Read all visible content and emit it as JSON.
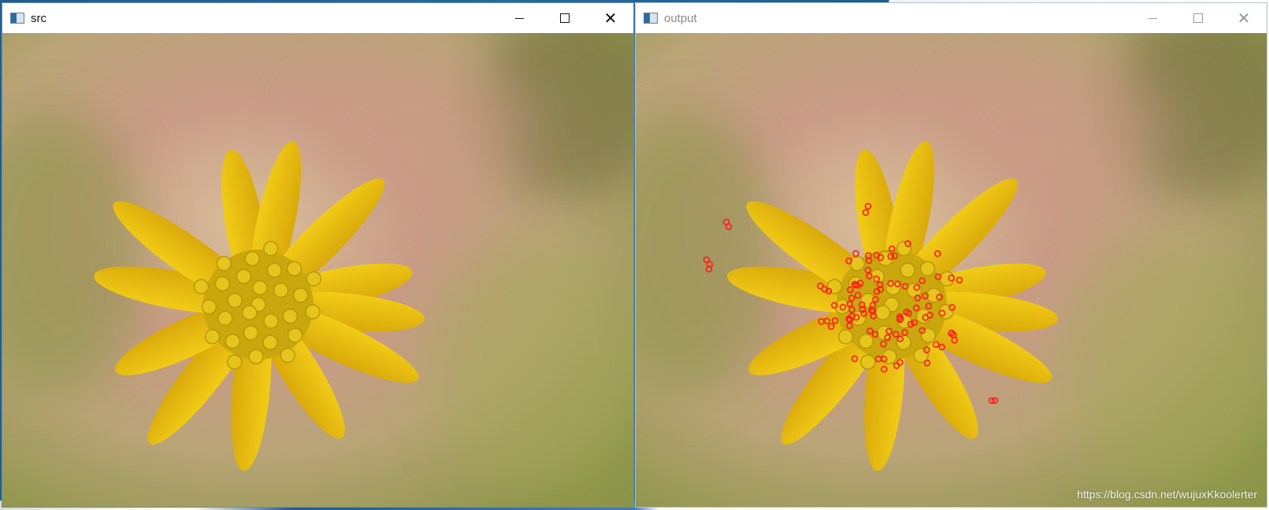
{
  "windows": [
    {
      "id": "src",
      "title": "src",
      "controls": {
        "minimize": "minimize",
        "maximize": "maximize",
        "close": "close"
      },
      "active": true
    },
    {
      "id": "output",
      "title": "output",
      "controls": {
        "minimize": "minimize",
        "maximize": "maximize",
        "close": "close"
      },
      "active": false
    }
  ],
  "image": {
    "subject": "yellow flower",
    "colors": {
      "petal": "#f2cc17",
      "petal_dark": "#d9a90a",
      "center": "#c9a70d",
      "bg_pink": "#c99b86",
      "bg_green": "#8c9548",
      "bg_sand": "#d7c18d"
    },
    "keypoint_color": "#ff1a1a",
    "keypoint_count_hint": "dozens"
  },
  "watermark": "https://blog.csdn.net/wujuxKkoolerter",
  "icons": {
    "app": "app-window-icon",
    "minimize": "minimize-icon",
    "maximize": "maximize-icon",
    "close": "close-icon"
  }
}
